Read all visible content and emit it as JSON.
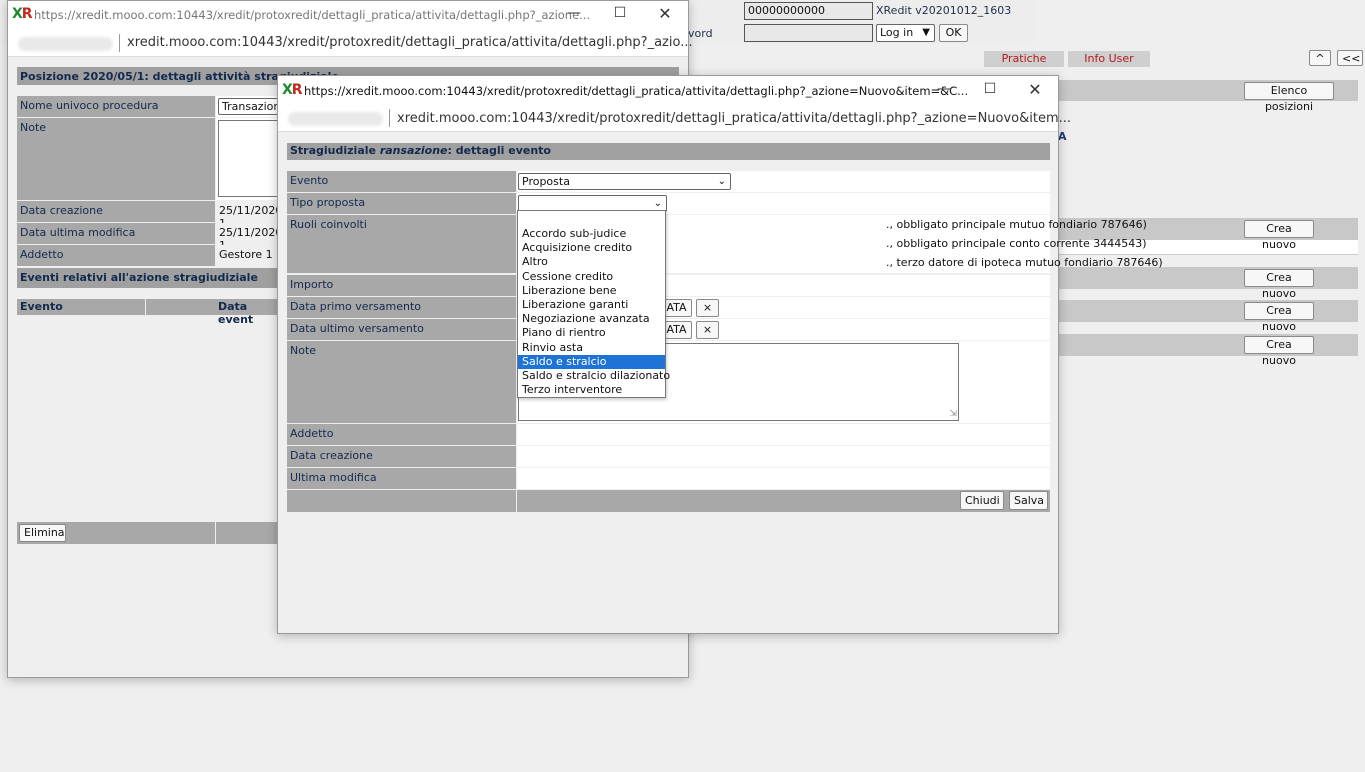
{
  "background_app": {
    "account_field": "00000000000",
    "version": "XRedit v20201012_1603",
    "password_label": "vord",
    "login_select": "Log in",
    "ok_button": "OK",
    "menu": {
      "pratiche": "Pratiche",
      "info_user": "Info User"
    },
    "nav_up": "^",
    "nav_back": "<<",
    "elenco_posizioni": "Elenco posizioni",
    "crea_nuovo": "Crea nuovo",
    "fragment_a": "A"
  },
  "window_back": {
    "title_url": "https://xredit.mooo.com:10443/xredit/protoxredit/dettagli_pratica/attivita/dettagli.php?_azione...",
    "address": "xredit.mooo.com:10443/xredit/protoxredit/dettagli_pratica/attivita/dettagli.php?_azio...",
    "header": "Posizione 2020/05/1: dettagli attività stragiudiziale",
    "rows": {
      "nome_label": "Nome univoco procedura",
      "nome_value": "Transazione",
      "note_label": "Note",
      "data_creazione_label": "Data creazione",
      "data_creazione_value": "25/11/2020 1",
      "data_modifica_label": "Data ultima modifica",
      "data_modifica_value": "25/11/2020 1",
      "addetto_label": "Addetto",
      "addetto_value": "Gestore 1"
    },
    "events_header": "Eventi relativi all'azione stragiudiziale",
    "col_evento": "Evento",
    "col_data": "Data event",
    "elimina_button": "Elimina"
  },
  "window_front": {
    "title_url": "https://xredit.mooo.com:10443/xredit/protoxredit/dettagli_pratica/attivita/dettagli.php?_azione=Nuovo&item=&C...",
    "address": "xredit.mooo.com:10443/xredit/protoxredit/dettagli_pratica/attivita/dettagli.php?_azione=Nuovo&item...",
    "header_prefix": "Stragiudiziale ",
    "header_italic": "ransazione",
    "header_suffix": ": dettagli evento",
    "fields": {
      "evento_label": "Evento",
      "evento_value": "Proposta",
      "tipo_label": "Tipo proposta",
      "tipo_value": "",
      "ruoli_label": "Ruoli coinvolti",
      "ruoli": [
        "., obbligato principale mutuo fondiario 787646)",
        "., obbligato principale conto corrente 3444543)",
        "., terzo datore di ipoteca mutuo fondiario 787646)"
      ],
      "importo_label": "Importo",
      "primo_label": "Data primo versamento",
      "ultimo_label": "Data ultimo versamento",
      "data_btn": "ATA",
      "clear_btn": "×",
      "note_label": "Note",
      "addetto_label": "Addetto",
      "creazione_label": "Data creazione",
      "modifica_label": "Ultima modifica"
    },
    "chiudi_button": "Chiudi",
    "salva_button": "Salva",
    "dropdown_options": [
      "",
      "Accordo sub-judice",
      "Acquisizione credito",
      "Altro",
      "Cessione credito",
      "Liberazione bene",
      "Liberazione garanti",
      "Negoziazione avanzata",
      "Piano di rientro",
      "Rinvio asta",
      "Saldo e stralcio",
      "Saldo e stralcio dilazionato",
      "Terzo interventore"
    ],
    "dropdown_selected": "Saldo e stralcio"
  }
}
